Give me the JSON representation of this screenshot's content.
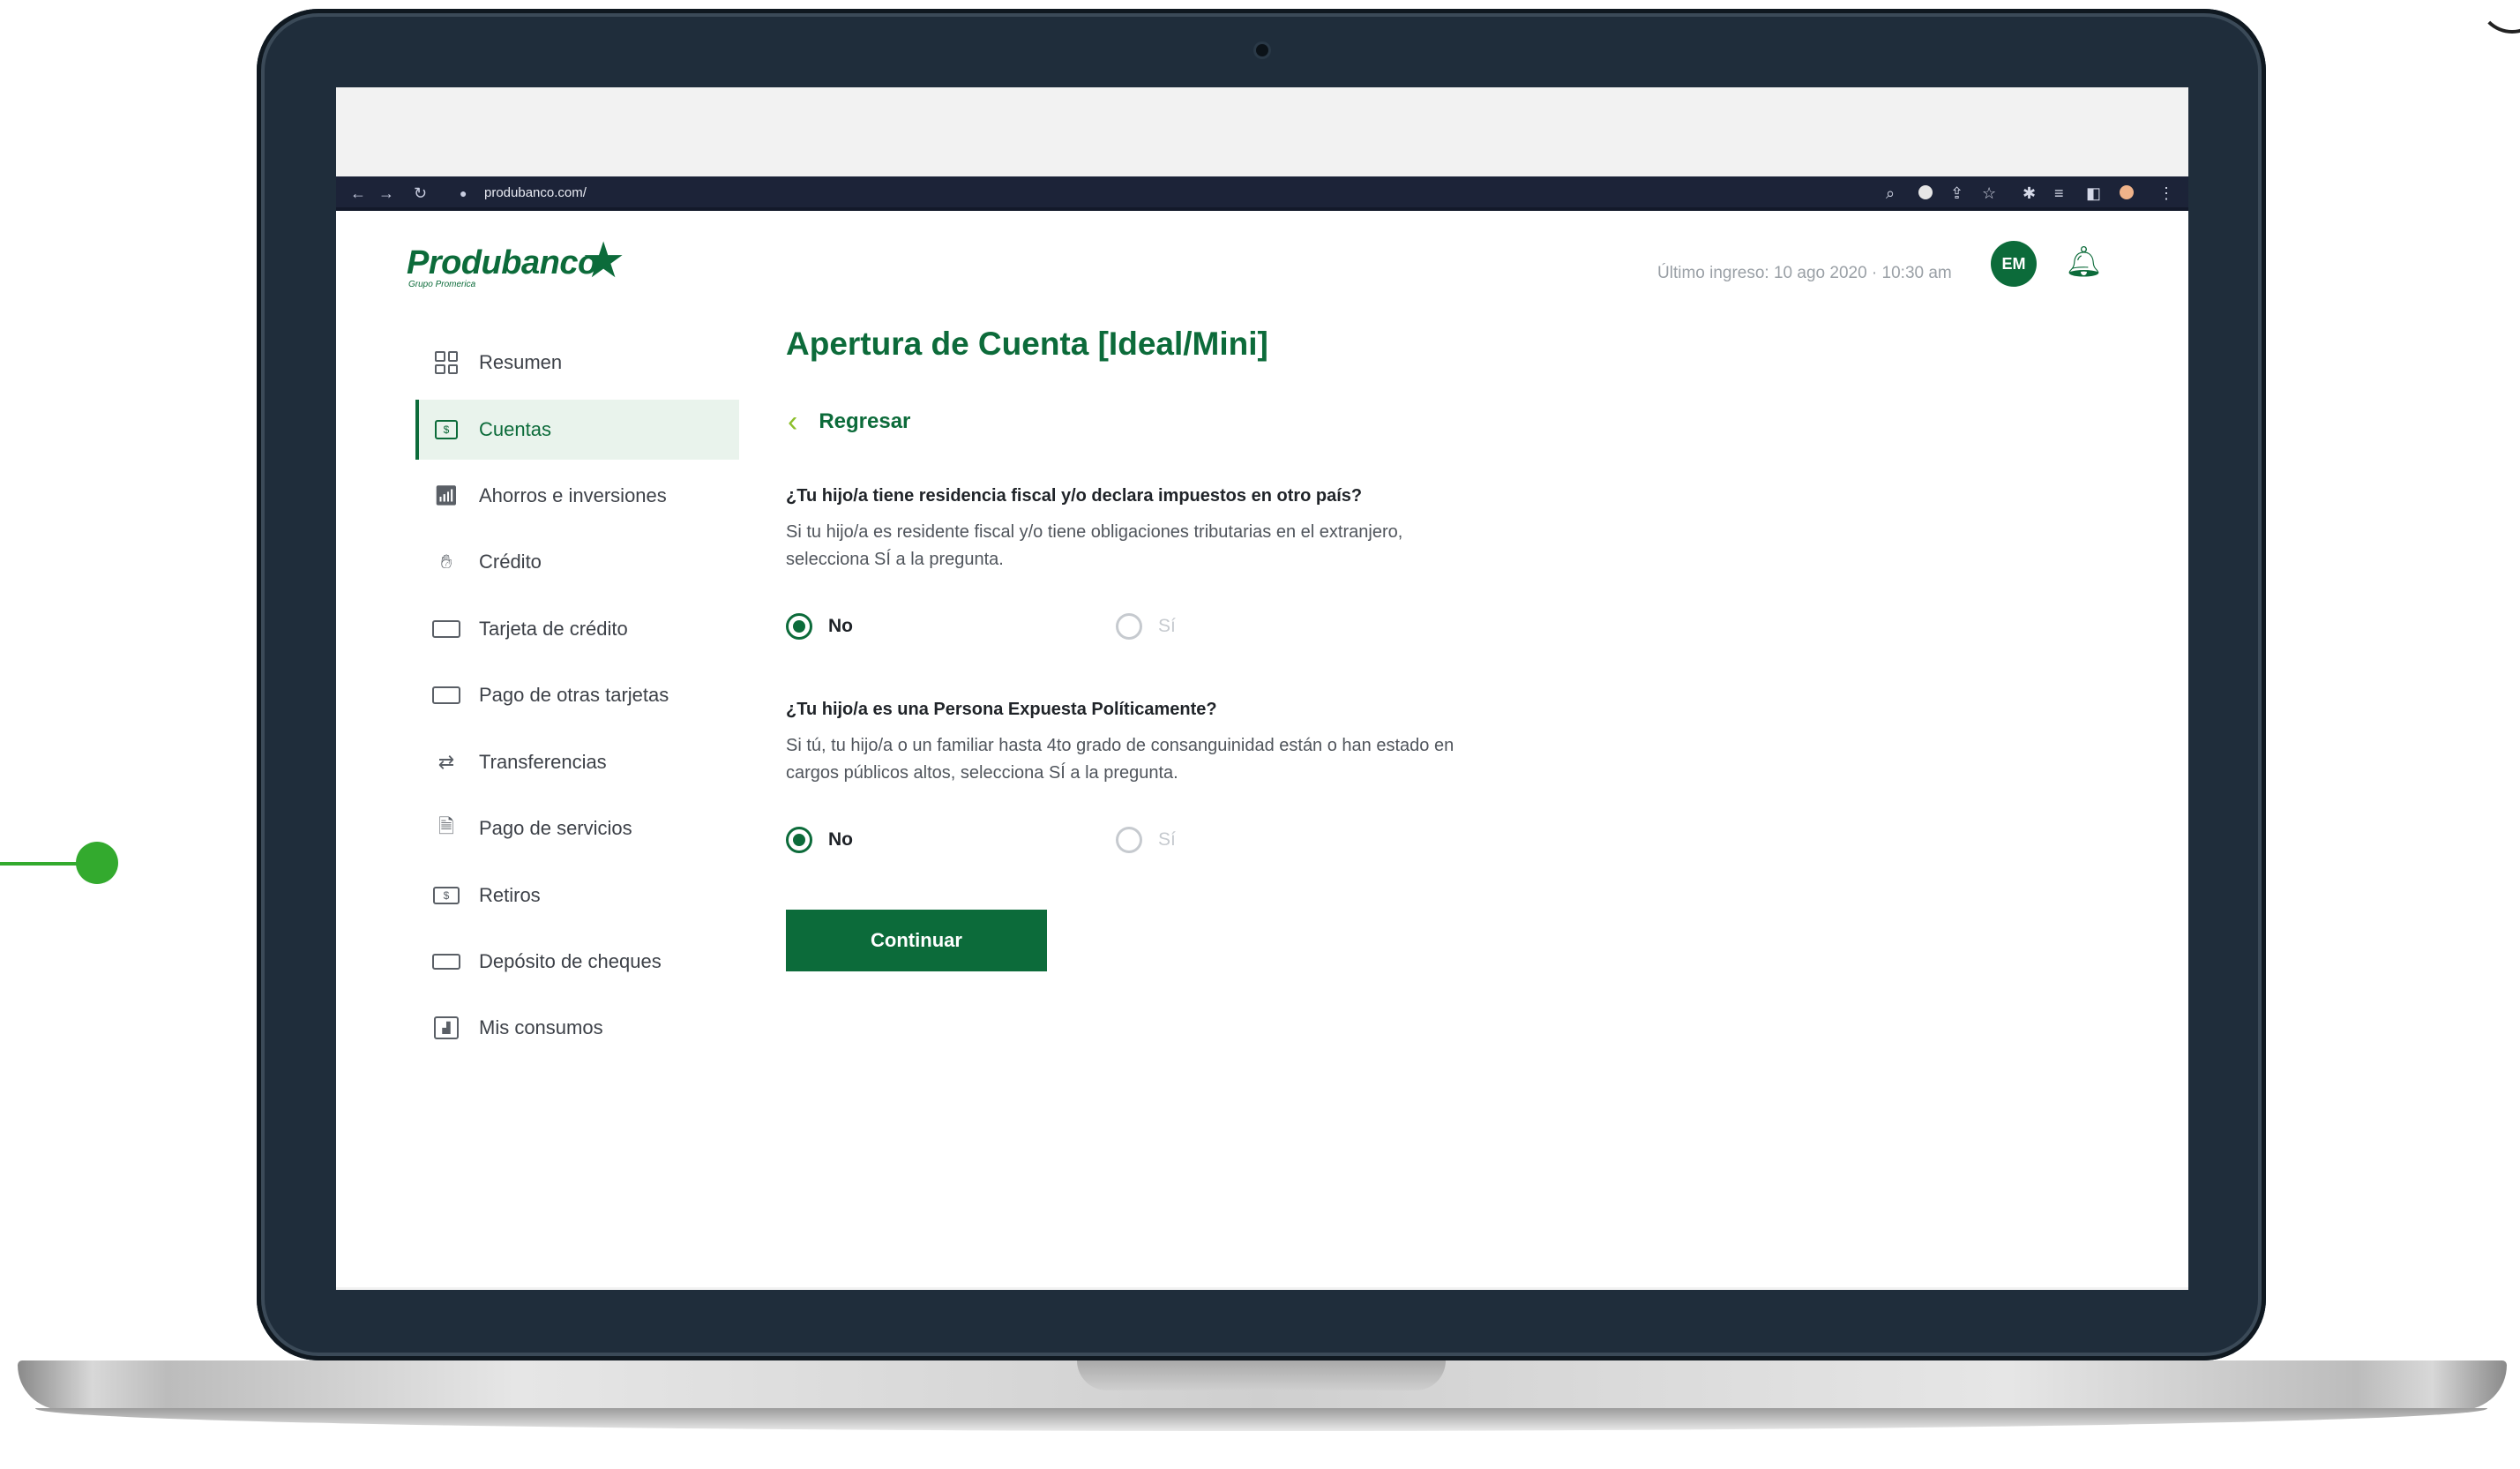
{
  "browser": {
    "url": "produbanco.com/"
  },
  "brand": {
    "name": "Produbanco",
    "tagline": "Grupo Promerica",
    "primary_color": "#0c6b3a",
    "accent_color": "#8cbf2a"
  },
  "header": {
    "last_login": "Último ingreso: 10 ago 2020 · 10:30 am",
    "avatar_initials": "EM"
  },
  "sidebar": {
    "items": [
      {
        "label": "Resumen",
        "icon": "grid-icon",
        "active": false
      },
      {
        "label": "Cuentas",
        "icon": "cash-icon",
        "active": true
      },
      {
        "label": "Ahorros e inversiones",
        "icon": "growth-chart-icon",
        "active": false
      },
      {
        "label": "Crédito",
        "icon": "hand-coin-icon",
        "active": false
      },
      {
        "label": "Tarjeta de crédito",
        "icon": "credit-card-icon",
        "active": false
      },
      {
        "label": "Pago de otras tarjetas",
        "icon": "cards-icon",
        "active": false
      },
      {
        "label": "Transferencias",
        "icon": "transfer-icon",
        "active": false
      },
      {
        "label": "Pago de servicios",
        "icon": "bill-icon",
        "active": false
      },
      {
        "label": "Retiros",
        "icon": "atm-icon",
        "active": false
      },
      {
        "label": "Depósito de cheques",
        "icon": "check-icon",
        "active": false
      },
      {
        "label": "Mis consumos",
        "icon": "bar-chart-icon",
        "active": false
      }
    ]
  },
  "main": {
    "title": "Apertura de Cuenta [Ideal/Mini]",
    "back_label": "Regresar",
    "questions": [
      {
        "question": "¿Tu hijo/a tiene residencia fiscal y/o declara impuestos en otro país?",
        "description": "Si tu hijo/a es residente fiscal y/o tiene obligaciones tributarias en el extranjero, selecciona SÍ a la pregunta.",
        "option_no": "No",
        "option_yes": "Sí",
        "selected": "No"
      },
      {
        "question": "¿Tu hijo/a es una Persona Expuesta Políticamente?",
        "description": "Si tú, tu hijo/a o un familiar hasta 4to grado de consanguinidad están o han estado en cargos públicos altos, selecciona SÍ a la pregunta.",
        "option_no": "No",
        "option_yes": "Sí",
        "selected": "No"
      }
    ],
    "continue_label": "Continuar"
  }
}
